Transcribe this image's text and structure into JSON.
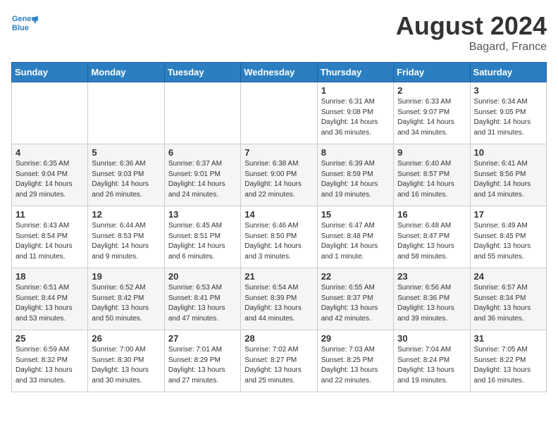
{
  "header": {
    "logo_line1": "General",
    "logo_line2": "Blue",
    "month": "August 2024",
    "location": "Bagard, France"
  },
  "days_of_week": [
    "Sunday",
    "Monday",
    "Tuesday",
    "Wednesday",
    "Thursday",
    "Friday",
    "Saturday"
  ],
  "weeks": [
    [
      {
        "day": "",
        "info": ""
      },
      {
        "day": "",
        "info": ""
      },
      {
        "day": "",
        "info": ""
      },
      {
        "day": "",
        "info": ""
      },
      {
        "day": "1",
        "info": "Sunrise: 6:31 AM\nSunset: 9:08 PM\nDaylight: 14 hours\nand 36 minutes."
      },
      {
        "day": "2",
        "info": "Sunrise: 6:33 AM\nSunset: 9:07 PM\nDaylight: 14 hours\nand 34 minutes."
      },
      {
        "day": "3",
        "info": "Sunrise: 6:34 AM\nSunset: 9:05 PM\nDaylight: 14 hours\nand 31 minutes."
      }
    ],
    [
      {
        "day": "4",
        "info": "Sunrise: 6:35 AM\nSunset: 9:04 PM\nDaylight: 14 hours\nand 29 minutes."
      },
      {
        "day": "5",
        "info": "Sunrise: 6:36 AM\nSunset: 9:03 PM\nDaylight: 14 hours\nand 26 minutes."
      },
      {
        "day": "6",
        "info": "Sunrise: 6:37 AM\nSunset: 9:01 PM\nDaylight: 14 hours\nand 24 minutes."
      },
      {
        "day": "7",
        "info": "Sunrise: 6:38 AM\nSunset: 9:00 PM\nDaylight: 14 hours\nand 22 minutes."
      },
      {
        "day": "8",
        "info": "Sunrise: 6:39 AM\nSunset: 8:59 PM\nDaylight: 14 hours\nand 19 minutes."
      },
      {
        "day": "9",
        "info": "Sunrise: 6:40 AM\nSunset: 8:57 PM\nDaylight: 14 hours\nand 16 minutes."
      },
      {
        "day": "10",
        "info": "Sunrise: 6:41 AM\nSunset: 8:56 PM\nDaylight: 14 hours\nand 14 minutes."
      }
    ],
    [
      {
        "day": "11",
        "info": "Sunrise: 6:43 AM\nSunset: 8:54 PM\nDaylight: 14 hours\nand 11 minutes."
      },
      {
        "day": "12",
        "info": "Sunrise: 6:44 AM\nSunset: 8:53 PM\nDaylight: 14 hours\nand 9 minutes."
      },
      {
        "day": "13",
        "info": "Sunrise: 6:45 AM\nSunset: 8:51 PM\nDaylight: 14 hours\nand 6 minutes."
      },
      {
        "day": "14",
        "info": "Sunrise: 6:46 AM\nSunset: 8:50 PM\nDaylight: 14 hours\nand 3 minutes."
      },
      {
        "day": "15",
        "info": "Sunrise: 6:47 AM\nSunset: 8:48 PM\nDaylight: 14 hours\nand 1 minute."
      },
      {
        "day": "16",
        "info": "Sunrise: 6:48 AM\nSunset: 8:47 PM\nDaylight: 13 hours\nand 58 minutes."
      },
      {
        "day": "17",
        "info": "Sunrise: 6:49 AM\nSunset: 8:45 PM\nDaylight: 13 hours\nand 55 minutes."
      }
    ],
    [
      {
        "day": "18",
        "info": "Sunrise: 6:51 AM\nSunset: 8:44 PM\nDaylight: 13 hours\nand 53 minutes."
      },
      {
        "day": "19",
        "info": "Sunrise: 6:52 AM\nSunset: 8:42 PM\nDaylight: 13 hours\nand 50 minutes."
      },
      {
        "day": "20",
        "info": "Sunrise: 6:53 AM\nSunset: 8:41 PM\nDaylight: 13 hours\nand 47 minutes."
      },
      {
        "day": "21",
        "info": "Sunrise: 6:54 AM\nSunset: 8:39 PM\nDaylight: 13 hours\nand 44 minutes."
      },
      {
        "day": "22",
        "info": "Sunrise: 6:55 AM\nSunset: 8:37 PM\nDaylight: 13 hours\nand 42 minutes."
      },
      {
        "day": "23",
        "info": "Sunrise: 6:56 AM\nSunset: 8:36 PM\nDaylight: 13 hours\nand 39 minutes."
      },
      {
        "day": "24",
        "info": "Sunrise: 6:57 AM\nSunset: 8:34 PM\nDaylight: 13 hours\nand 36 minutes."
      }
    ],
    [
      {
        "day": "25",
        "info": "Sunrise: 6:59 AM\nSunset: 8:32 PM\nDaylight: 13 hours\nand 33 minutes."
      },
      {
        "day": "26",
        "info": "Sunrise: 7:00 AM\nSunset: 8:30 PM\nDaylight: 13 hours\nand 30 minutes."
      },
      {
        "day": "27",
        "info": "Sunrise: 7:01 AM\nSunset: 8:29 PM\nDaylight: 13 hours\nand 27 minutes."
      },
      {
        "day": "28",
        "info": "Sunrise: 7:02 AM\nSunset: 8:27 PM\nDaylight: 13 hours\nand 25 minutes."
      },
      {
        "day": "29",
        "info": "Sunrise: 7:03 AM\nSunset: 8:25 PM\nDaylight: 13 hours\nand 22 minutes."
      },
      {
        "day": "30",
        "info": "Sunrise: 7:04 AM\nSunset: 8:24 PM\nDaylight: 13 hours\nand 19 minutes."
      },
      {
        "day": "31",
        "info": "Sunrise: 7:05 AM\nSunset: 8:22 PM\nDaylight: 13 hours\nand 16 minutes."
      }
    ]
  ]
}
